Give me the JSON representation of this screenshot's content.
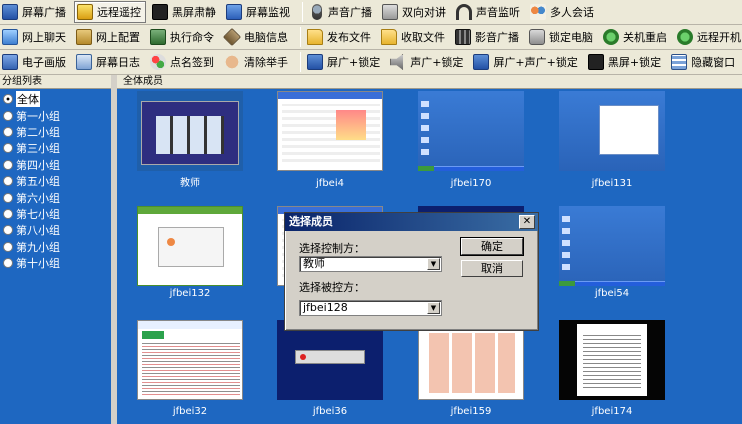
{
  "toolbar_rows": [
    [
      {
        "name": "screen-broadcast",
        "icon": "ico-screen",
        "label": "屏幕广播"
      },
      {
        "name": "remote-control",
        "icon": "ico-remote",
        "label": "远程遥控",
        "active": true
      },
      {
        "name": "black-screen",
        "icon": "ico-black",
        "label": "黑屏肃静"
      },
      {
        "name": "screen-monitor",
        "icon": "ico-monitor",
        "label": "屏幕监视"
      },
      {
        "sep": true
      },
      {
        "name": "voice-broadcast",
        "icon": "ico-mic",
        "label": "声音广播"
      },
      {
        "name": "two-way-talk",
        "icon": "ico-talk",
        "label": "双向对讲"
      },
      {
        "name": "voice-monitor",
        "icon": "ico-headset",
        "label": "声音监听"
      },
      {
        "name": "group-chat",
        "icon": "ico-people",
        "label": "多人会话"
      }
    ],
    [
      {
        "name": "online-chat",
        "icon": "ico-chat",
        "label": "网上聊天"
      },
      {
        "name": "online-config",
        "icon": "ico-cfg",
        "label": "网上配置"
      },
      {
        "name": "execute-command",
        "icon": "ico-cmd",
        "label": "执行命令"
      },
      {
        "name": "computer-info",
        "icon": "ico-info",
        "label": "电脑信息"
      },
      {
        "sep": true
      },
      {
        "name": "send-file",
        "icon": "ico-folder",
        "label": "发布文件"
      },
      {
        "name": "collect-file",
        "icon": "ico-folder",
        "label": "收取文件"
      },
      {
        "name": "video-broadcast",
        "icon": "ico-film",
        "label": "影音广播"
      },
      {
        "name": "lock-computer",
        "icon": "ico-lock",
        "label": "锁定电脑"
      },
      {
        "name": "shutdown-restart",
        "icon": "ico-power",
        "label": "关机重启"
      },
      {
        "name": "remote-power-on",
        "icon": "ico-power",
        "label": "远程开机"
      }
    ],
    [
      {
        "name": "whiteboard",
        "icon": "ico-board",
        "label": "电子画版"
      },
      {
        "name": "screen-log",
        "icon": "ico-log",
        "label": "屏幕日志"
      },
      {
        "name": "roll-call",
        "icon": "ico-sign",
        "label": "点名签到"
      },
      {
        "name": "clear-hand-raise",
        "icon": "ico-hand",
        "label": "清除举手"
      },
      {
        "sep": true
      },
      {
        "name": "screen-broadcast-lock",
        "icon": "ico-screen",
        "label": "屏广+锁定"
      },
      {
        "name": "voice-broadcast-lock",
        "icon": "ico-speaker",
        "label": "声广+锁定"
      },
      {
        "name": "screen-voice-broadcast-lock",
        "icon": "ico-screen",
        "label": "屏广+声广+锁定"
      },
      {
        "name": "black-screen-lock",
        "icon": "ico-black",
        "label": "黑屏+锁定"
      },
      {
        "name": "hide-window",
        "icon": "ico-hide",
        "label": "隐藏窗口"
      }
    ]
  ],
  "group_panel": {
    "header": "分组列表",
    "items": [
      "全体",
      "第一小组",
      "第二小组",
      "第三小组",
      "第四小组",
      "第五小组",
      "第六小组",
      "第七小组",
      "第八小组",
      "第九小组",
      "第十小组"
    ],
    "selected": 0
  },
  "member_panel": {
    "header": "全体成员",
    "members": [
      {
        "name": "教师",
        "style": "thumb-teacher"
      },
      {
        "name": "jfbei4",
        "style": "thumb-app"
      },
      {
        "name": "jfbei170",
        "style": "thumb-desktop"
      },
      {
        "name": "jfbei131",
        "style": "thumb-app2"
      },
      {
        "name": "jfbei132",
        "style": "thumb-green"
      },
      {
        "name": "",
        "style": "thumb-app"
      },
      {
        "name": "",
        "style": "thumb-navy"
      },
      {
        "name": "jfbei54",
        "style": "thumb-desktop"
      },
      {
        "name": "jfbei32",
        "style": "thumb-web"
      },
      {
        "name": "jfbei36",
        "style": "thumb-navy"
      },
      {
        "name": "jfbei159",
        "style": "thumb-pics"
      },
      {
        "name": "jfbei174",
        "style": "thumb-dark"
      }
    ]
  },
  "dialog": {
    "title": "选择成员",
    "close_symbol": "✕",
    "controller_label": "选择控制方：",
    "controller_value": "教师",
    "controlled_label": "选择被控方：",
    "controlled_value": "jfbei128",
    "ok_label": "确定",
    "cancel_label": "取消"
  }
}
